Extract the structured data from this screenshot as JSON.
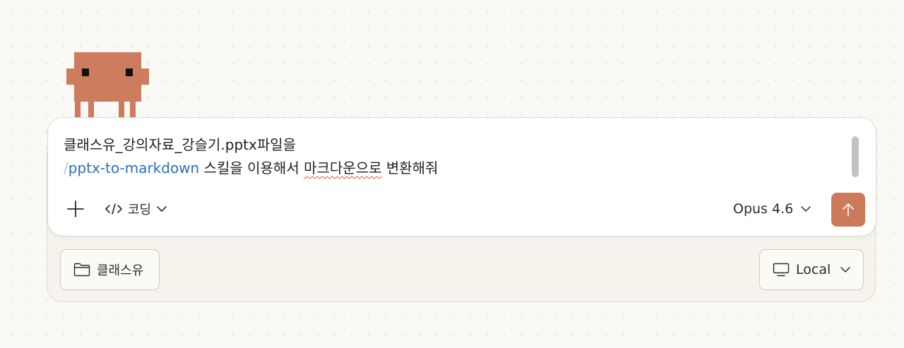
{
  "app": {
    "accent": "#cd7a5b",
    "background": "#faf9f5",
    "mascot_icon": "pixel-crab-mascot"
  },
  "composer": {
    "line1": "클래스유_강의자료_강슬기.pptx파일을",
    "slash": "/",
    "command": "pptx-to-markdown",
    "line2_before": " 스킬을 이용해서 ",
    "line2_underlined": "마크다운으로",
    "line2_after": " 변환해줘",
    "command_color": "#2a6fc0"
  },
  "toolbar": {
    "add_icon": "plus-icon",
    "mode_icon": "code-icon",
    "mode_label": "코딩",
    "model_label": "Opus 4.6",
    "send_icon": "arrow-up-icon"
  },
  "footer": {
    "folder_icon": "folder-icon",
    "folder_label": "클래스유",
    "env_icon": "monitor-icon",
    "env_label": "Local"
  }
}
